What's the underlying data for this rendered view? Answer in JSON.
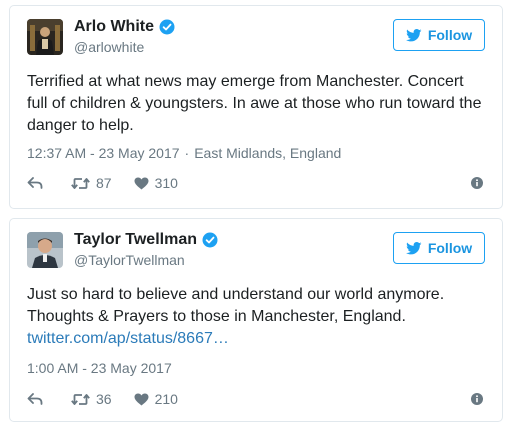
{
  "colors": {
    "link": "#2b7bb9",
    "follow_blue": "#1da1f2",
    "muted": "#697882",
    "border": "#e1e8ed",
    "text": "#1c2022"
  },
  "tweets": [
    {
      "display_name": "Arlo White",
      "handle": "@arlowhite",
      "verified": true,
      "follow_label": "Follow",
      "text_lines": [
        "Terrified at what news may emerge from Manchester. Concert",
        "full of children & youngsters. In awe at those who run toward the",
        "danger to help."
      ],
      "link": "",
      "timestamp": "12:37 AM - 23 May 2017",
      "location": "East Midlands, England",
      "retweets": "87",
      "likes": "310",
      "icons": [
        "reply-icon",
        "retweet-icon",
        "heart-icon",
        "info-icon",
        "verified-icon",
        "twitter-bird-icon"
      ]
    },
    {
      "display_name": "Taylor Twellman",
      "handle": "@TaylorTwellman",
      "verified": true,
      "follow_label": "Follow",
      "text_lines": [
        "Just so hard to believe and understand our world anymore.",
        "Thoughts & Prayers to those in Manchester, England."
      ],
      "link": "twitter.com/ap/status/8667…",
      "timestamp": "1:00 AM - 23 May 2017",
      "location": "",
      "retweets": "36",
      "likes": "210",
      "icons": [
        "reply-icon",
        "retweet-icon",
        "heart-icon",
        "info-icon",
        "verified-icon",
        "twitter-bird-icon"
      ]
    }
  ]
}
